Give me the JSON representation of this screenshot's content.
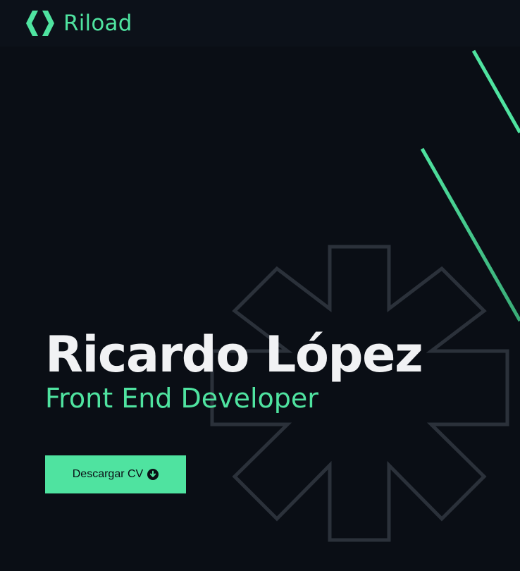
{
  "header": {
    "brand_name": "Riload",
    "logo_icon": "riload-logo-icon"
  },
  "hero": {
    "name": "Ricardo López",
    "role": "Front End Developer",
    "cv_button_label": "Descargar CV",
    "cv_button_icon": "arrow-down-circle-icon"
  },
  "colors": {
    "background": "#0a0e15",
    "header_background": "#0c1119",
    "accent": "#4fe3a0",
    "text": "#f1f2f4",
    "asterisk_outline": "#2b313a"
  }
}
